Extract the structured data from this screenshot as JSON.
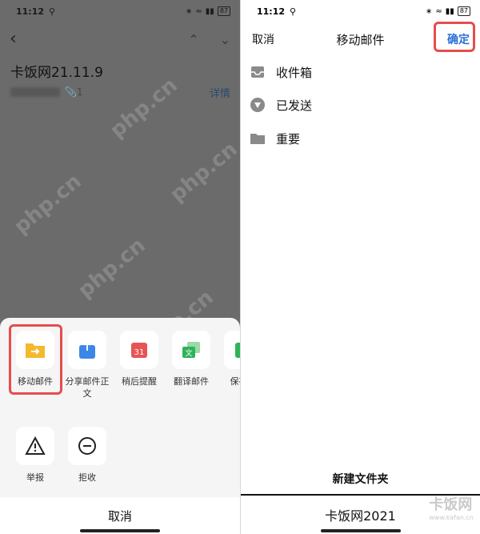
{
  "left": {
    "status": {
      "time": "11:12",
      "battery": "87"
    },
    "mail": {
      "title": "卡饭网21.11.9",
      "attach_count": "1",
      "detail_label": "详情"
    },
    "watermark": "php.cn",
    "actions_row1": [
      {
        "label": "移动邮件",
        "icon": "move-folder-icon"
      },
      {
        "label": "分享邮件正文",
        "icon": "share-icon"
      },
      {
        "label": "稍后提醒",
        "icon": "calendar-icon"
      },
      {
        "label": "翻译邮件",
        "icon": "translate-icon"
      },
      {
        "label": "保存至",
        "icon": "save-icon"
      }
    ],
    "actions_row2": [
      {
        "label": "举报",
        "icon": "warning-icon"
      },
      {
        "label": "拒收",
        "icon": "block-icon"
      }
    ],
    "cancel_label": "取消"
  },
  "right": {
    "status": {
      "time": "11:12",
      "battery": "87"
    },
    "nav": {
      "cancel": "取消",
      "title": "移动邮件",
      "confirm": "确定"
    },
    "folders": [
      {
        "name": "收件箱",
        "icon": "inbox-icon"
      },
      {
        "name": "已发送",
        "icon": "sent-icon"
      },
      {
        "name": "重要",
        "icon": "folder-icon"
      }
    ],
    "new_folder_label": "新建文件夹",
    "new_folder_value": "卡饭网2021",
    "brand_watermark": "卡饭网",
    "brand_url": "www.kafan.cn"
  },
  "colors": {
    "accent": "#2b6fd6",
    "highlight": "#e84c4c"
  }
}
